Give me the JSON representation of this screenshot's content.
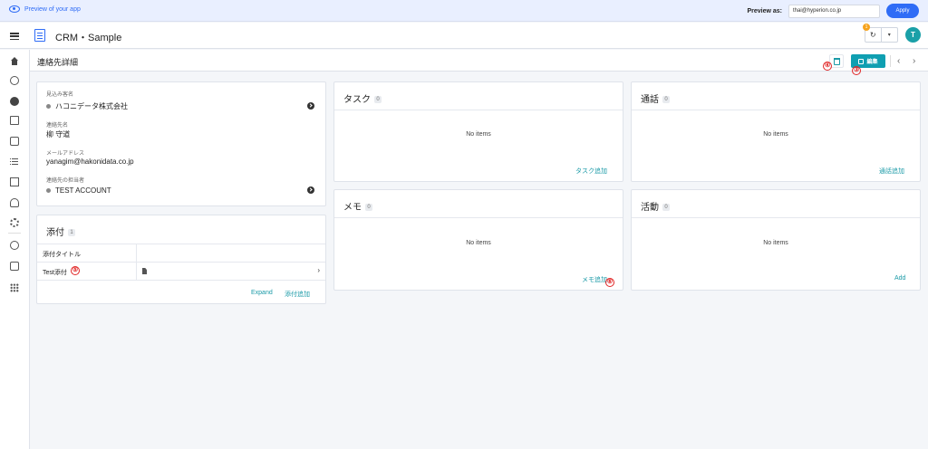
{
  "preview_bar": {
    "left_text": "Preview of your app",
    "preview_as_label": "Preview as:",
    "preview_email": "thai@hyperion.co.jp",
    "apply_label": "Apply"
  },
  "topbar": {
    "app_title": "CRM・Sample",
    "badge_count": "1",
    "avatar_letter": "T"
  },
  "subheader": {
    "title": "連絡先詳細",
    "edit_label": "編集",
    "prev": "‹",
    "next": "›"
  },
  "markers": {
    "m3": "③",
    "m4": "④",
    "m5": "⑤",
    "m6": "⑥"
  },
  "details": {
    "prospect_label": "見込み客名",
    "prospect_value": "ハコニデータ株式会社",
    "contact_name_label": "連絡先名",
    "contact_name_value": "柳 守道",
    "email_label": "メールアドレス",
    "email_value": "yanagim@hakonidata.co.jp",
    "owner_label": "連絡先の担当者",
    "owner_value": "TEST ACCOUNT"
  },
  "attachments": {
    "title": "添付",
    "count": "1",
    "header_col": "添付タイトル",
    "row_title": "Test添付",
    "expand_label": "Expand",
    "add_label": "添付追加"
  },
  "tasks": {
    "title": "タスク",
    "count": "0",
    "empty": "No items",
    "add_label": "タスク追加"
  },
  "calls": {
    "title": "通話",
    "count": "0",
    "empty": "No items",
    "add_label": "通話追加"
  },
  "memos": {
    "title": "メモ",
    "count": "0",
    "empty": "No items",
    "add_label": "メモ追加"
  },
  "activities": {
    "title": "活動",
    "count": "0",
    "empty": "No items",
    "add_label": "Add"
  },
  "colors": {
    "accent": "#1a9aa7",
    "primary_blue": "#2f6cf6",
    "badge_orange": "#f6a31d",
    "marker_red": "#e12626"
  }
}
